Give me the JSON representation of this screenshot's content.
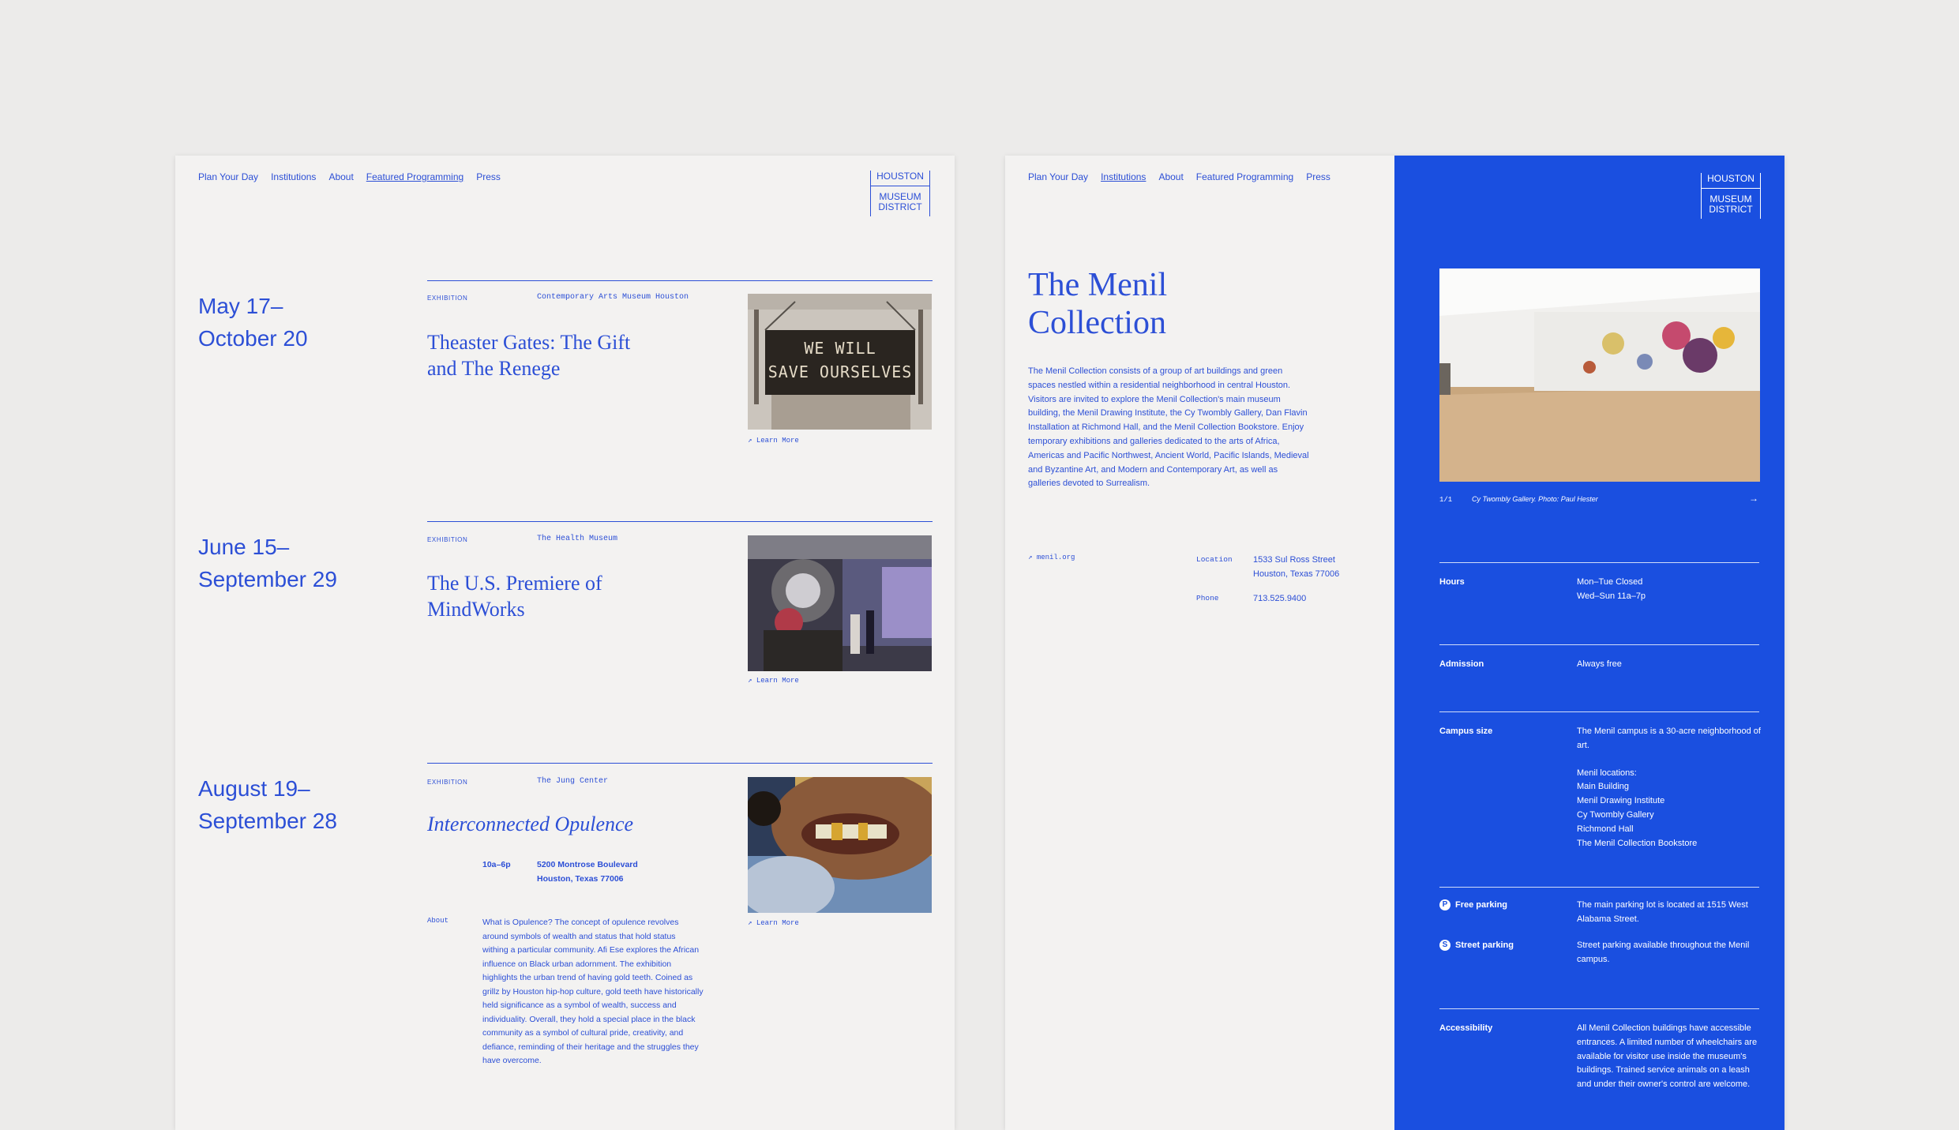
{
  "left": {
    "nav": [
      "Plan Your Day",
      "Institutions",
      "About",
      "Featured Programming",
      "Press"
    ],
    "nav_active": 3,
    "logo": {
      "top": "HOUSTON",
      "bottom_line1": "MUSEUM",
      "bottom_line2": "DISTRICT"
    },
    "events": [
      {
        "date_line1": "May 17–",
        "date_line2": "October 20",
        "type": "EXHIBITION",
        "venue": "Contemporary Arts Museum Houston",
        "title": "Theaster Gates: The Gift and The Renege",
        "image_text_line1": "WE WILL",
        "image_text_line2": "SAVE OURSELVES",
        "learn_more": "Learn More"
      },
      {
        "date_line1": "June 15–",
        "date_line2": "September 29",
        "type": "EXHIBITION",
        "venue": "The Health Museum",
        "title": "The U.S. Premiere of MindWorks",
        "learn_more": "Learn More"
      },
      {
        "date_line1": "August 19–",
        "date_line2": "September 28",
        "type": "EXHIBITION",
        "venue": "The Jung Center",
        "title": "Interconnected Opulence",
        "hours": "10a–6p",
        "address_line1": "5200 Montrose Boulevard",
        "address_line2": "Houston, Texas 77006",
        "about_label": "About",
        "about_text": "What is Opulence? The concept of opulence revolves around symbols of wealth and status that hold status withing a particular community. Afi Ese explores the African influence on Black urban adornment. The exhibition highlights the urban trend of having gold teeth. Coined as grillz by Houston hip-hop culture, gold teeth have historically held significance as a symbol of wealth, success and individuality. Overall, they hold a special place in the black community as a symbol of cultural pride, creativity, and defiance, reminding of their heritage and the struggles they have overcome.",
        "learn_more": "Learn More"
      }
    ]
  },
  "right": {
    "nav": [
      "Plan Your Day",
      "Institutions",
      "About",
      "Featured Programming",
      "Press"
    ],
    "nav_active": 1,
    "logo": {
      "top": "HOUSTON",
      "bottom_line1": "MUSEUM",
      "bottom_line2": "DISTRICT"
    },
    "title_line1": "The Menil",
    "title_line2": "Collection",
    "description": "The Menil Collection consists of a group of art buildings and green spaces nestled within a residential neighborhood in central Houston. Visitors are invited to explore the Menil Collection's main museum building, the Menil Drawing Institute, the Cy Twombly Gallery, Dan Flavin Installation at Richmond Hall, and the Menil Collection Bookstore. Enjoy temporary exhibitions and galleries dedicated to the arts of Africa, Americas and Pacific Northwest, Ancient World, Pacific Islands, Medieval and Byzantine Art, and Modern and Contemporary Art, as well as galleries devoted to Surrealism.",
    "website": "menil.org",
    "location_label": "Location",
    "location_line1": "1533 Sul Ross Street",
    "location_line2": "Houston, Texas 77006",
    "phone_label": "Phone",
    "phone": "713.525.9400",
    "gallery_counter": "1/1",
    "gallery_caption": "Cy Twombly Gallery. Photo: Paul Hester",
    "hours_label": "Hours",
    "hours_line1": "Mon–Tue Closed",
    "hours_line2": "Wed–Sun 11a–7p",
    "admission_label": "Admission",
    "admission": "Always free",
    "campus_label": "Campus size",
    "campus_text": "The Menil campus is a 30-acre neighborhood of art.",
    "locations_heading": "Menil locations:",
    "locations": [
      "Main Building",
      "Menil Drawing Institute",
      "Cy Twombly Gallery",
      "Richmond Hall",
      "The Menil Collection Bookstore"
    ],
    "free_parking_icon": "P",
    "free_parking_label": "Free parking",
    "free_parking_text": "The main parking lot is located at 1515 West Alabama Street.",
    "street_parking_icon": "S",
    "street_parking_label": "Street parking",
    "street_parking_text": "Street parking available throughout the Menil campus.",
    "accessibility_label": "Accessibility",
    "accessibility_text": "All Menil Collection buildings have accessible entrances. A limited number of wheelchairs are available for visitor use inside the museum's buildings. Trained service animals on a leash and under their owner's control are welcome."
  },
  "colors": {
    "accent": "#2c4fd6",
    "panel_blue": "#1a4fe0",
    "panel_bg": "#f3f2f1",
    "page_bg": "#ecebea"
  }
}
